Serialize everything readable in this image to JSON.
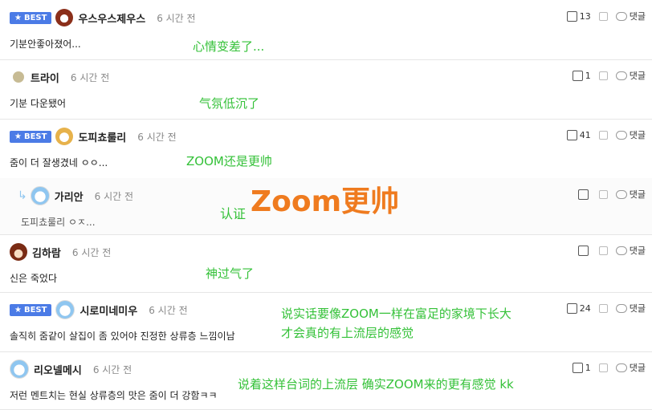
{
  "comments": [
    {
      "badge": "BEST",
      "nick": "우스우스제우스",
      "time": "6 시간 전",
      "text": "기분안좋아졌어...",
      "likes": "13",
      "reply_label": "댓글"
    },
    {
      "badge": "",
      "nick": "트라이",
      "time": "6 시간 전",
      "text": "기분 다운됐어",
      "likes": "1",
      "reply_label": "댓글"
    },
    {
      "badge": "BEST",
      "nick": "도피쵸룰리",
      "time": "6 시간 전",
      "text": "줌이 더 잘생겼네 ㅇㅇ...",
      "likes": "41",
      "reply_label": "댓글"
    },
    {
      "badge": "",
      "nick": "가리안",
      "time": "6 시간 전",
      "text": "도피쵸룰리 ㅇㅈ...",
      "likes": "",
      "reply_label": "댓글"
    },
    {
      "badge": "",
      "nick": "김하람",
      "time": "6 시간 전",
      "text": "신은 죽었다",
      "likes": "",
      "reply_label": "댓글"
    },
    {
      "badge": "BEST",
      "nick": "시로미네미우",
      "time": "6 시간 전",
      "text": "솔직히 줌같이 살집이 좀 있어야 진정한 상류층 느낌이남",
      "likes": "24",
      "reply_label": "댓글"
    },
    {
      "badge": "",
      "nick": "리오넬메시",
      "time": "6 시간 전",
      "text": "저런 멘트치는 현실 상류층의 맛은 줌이 더 강함ㅋㅋ",
      "likes": "1",
      "reply_label": "댓글"
    }
  ],
  "annotations": {
    "a1": "心情变差了...",
    "a2": "气氛低沉了",
    "a3": "ZOOM还是更帅",
    "a4_small": "认证",
    "a4_big": "Zoom更帅",
    "a5": "神过气了",
    "a6_line1": "说实话要像ZOOM一样在富足的家境下长大",
    "a6_line2": "才会真的有上流层的感觉",
    "a7": "说着这样台词的上流层 确实ZOOM来的更有感觉 kk"
  }
}
